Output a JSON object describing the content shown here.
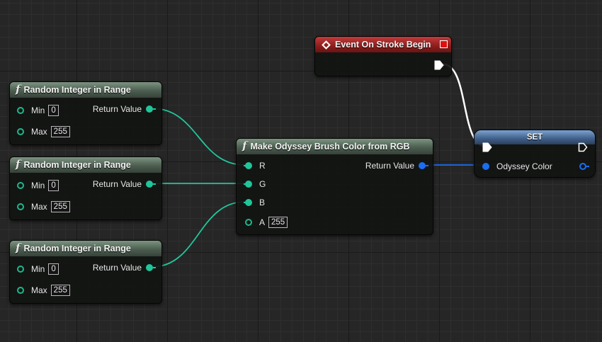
{
  "canvas": {
    "background": "#262626",
    "grid_minor": "#2e2e2e",
    "grid_major": "#1a1a1a"
  },
  "colors": {
    "int_wire": "#20c69a",
    "struct_wire": "#1b6ef2",
    "exec_wire": "#ffffff",
    "event_header": "#8c1d1d",
    "func_header": "#4c5e50",
    "set_header": "#3f5f88"
  },
  "event_node": {
    "title": "Event On Stroke Begin",
    "icon": "event-diamond-icon"
  },
  "random_nodes": [
    {
      "title": "Random Integer in Range",
      "min_label": "Min",
      "min_value": "0",
      "max_label": "Max",
      "max_value": "255",
      "return_label": "Return Value"
    },
    {
      "title": "Random Integer in Range",
      "min_label": "Min",
      "min_value": "0",
      "max_label": "Max",
      "max_value": "255",
      "return_label": "Return Value"
    },
    {
      "title": "Random Integer in Range",
      "min_label": "Min",
      "min_value": "0",
      "max_label": "Max",
      "max_value": "255",
      "return_label": "Return Value"
    }
  ],
  "make_node": {
    "title": "Make Odyssey Brush Color from RGB",
    "inputs": {
      "r": "R",
      "g": "G",
      "b": "B",
      "a": "A"
    },
    "a_value": "255",
    "return_label": "Return Value"
  },
  "set_node": {
    "title": "SET",
    "var_label": "Odyssey Color"
  },
  "icon_glyphs": {
    "function": "f"
  }
}
